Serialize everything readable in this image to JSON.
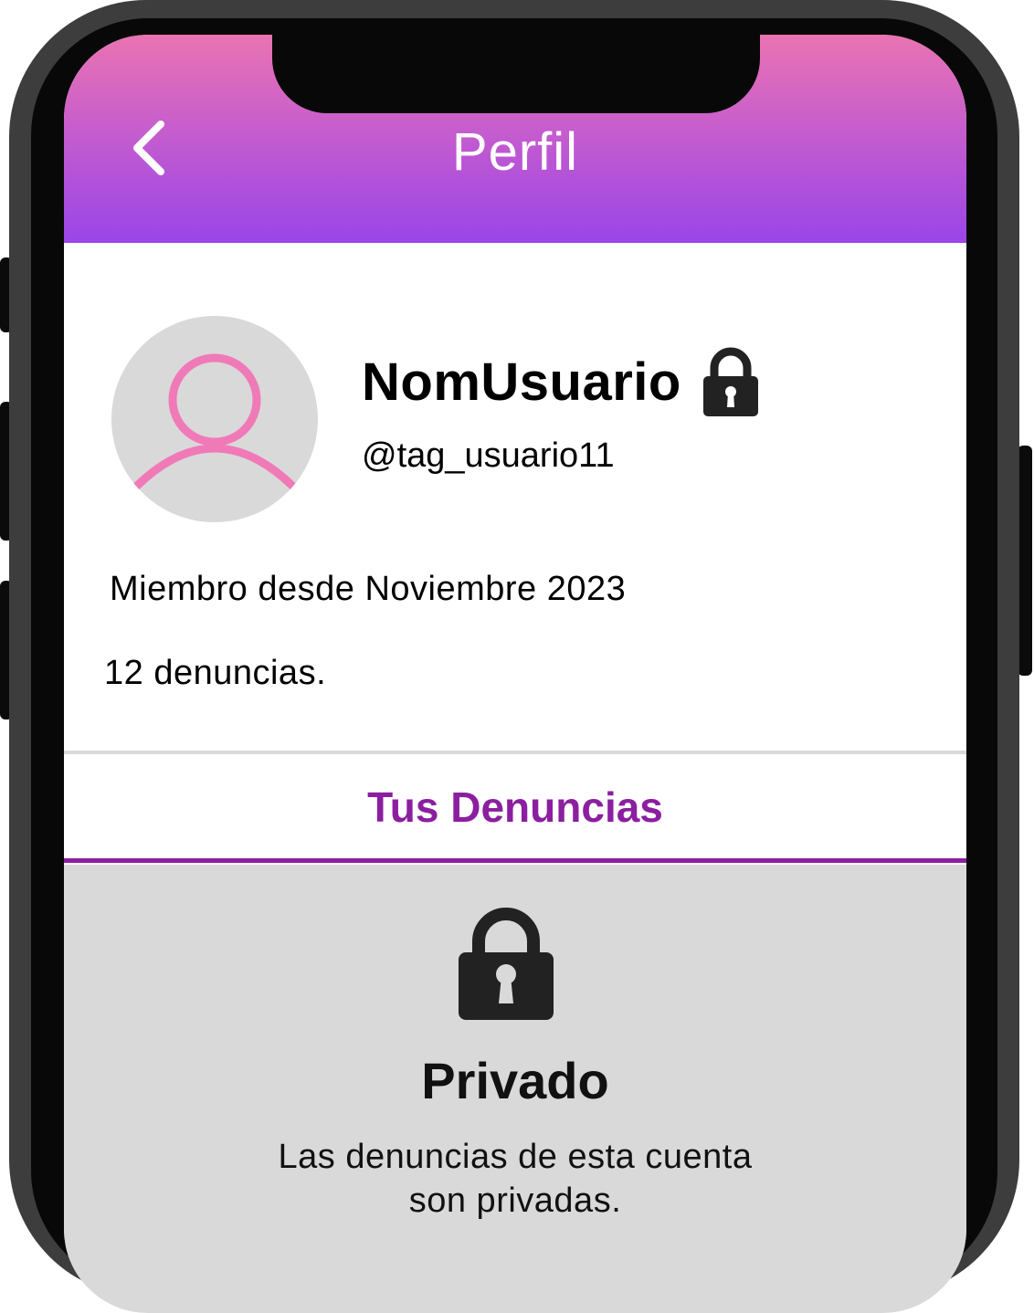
{
  "header": {
    "title": "Perfil",
    "back_icon": "chevron-left-icon",
    "gradient_top": "#ea73b2",
    "gradient_bottom": "#9a45e8"
  },
  "profile": {
    "username": "NomUsuario",
    "handle": "@tag_usuario11",
    "privacy_icon": "lock-icon",
    "avatar_icon": "user-outline-icon",
    "member_since": "Miembro desde Noviembre 2023",
    "report_count": "12 denuncias."
  },
  "tabs": [
    {
      "label": "Tus Denuncias",
      "active": true
    }
  ],
  "private_notice": {
    "icon": "lock-icon",
    "title": "Privado",
    "message_line1": "Las denuncias de esta cuenta",
    "message_line2": "son privadas."
  },
  "colors": {
    "accent": "#8b1fa0",
    "avatar_stroke": "#f07ab8",
    "panel_bg": "#d9d9d9"
  }
}
